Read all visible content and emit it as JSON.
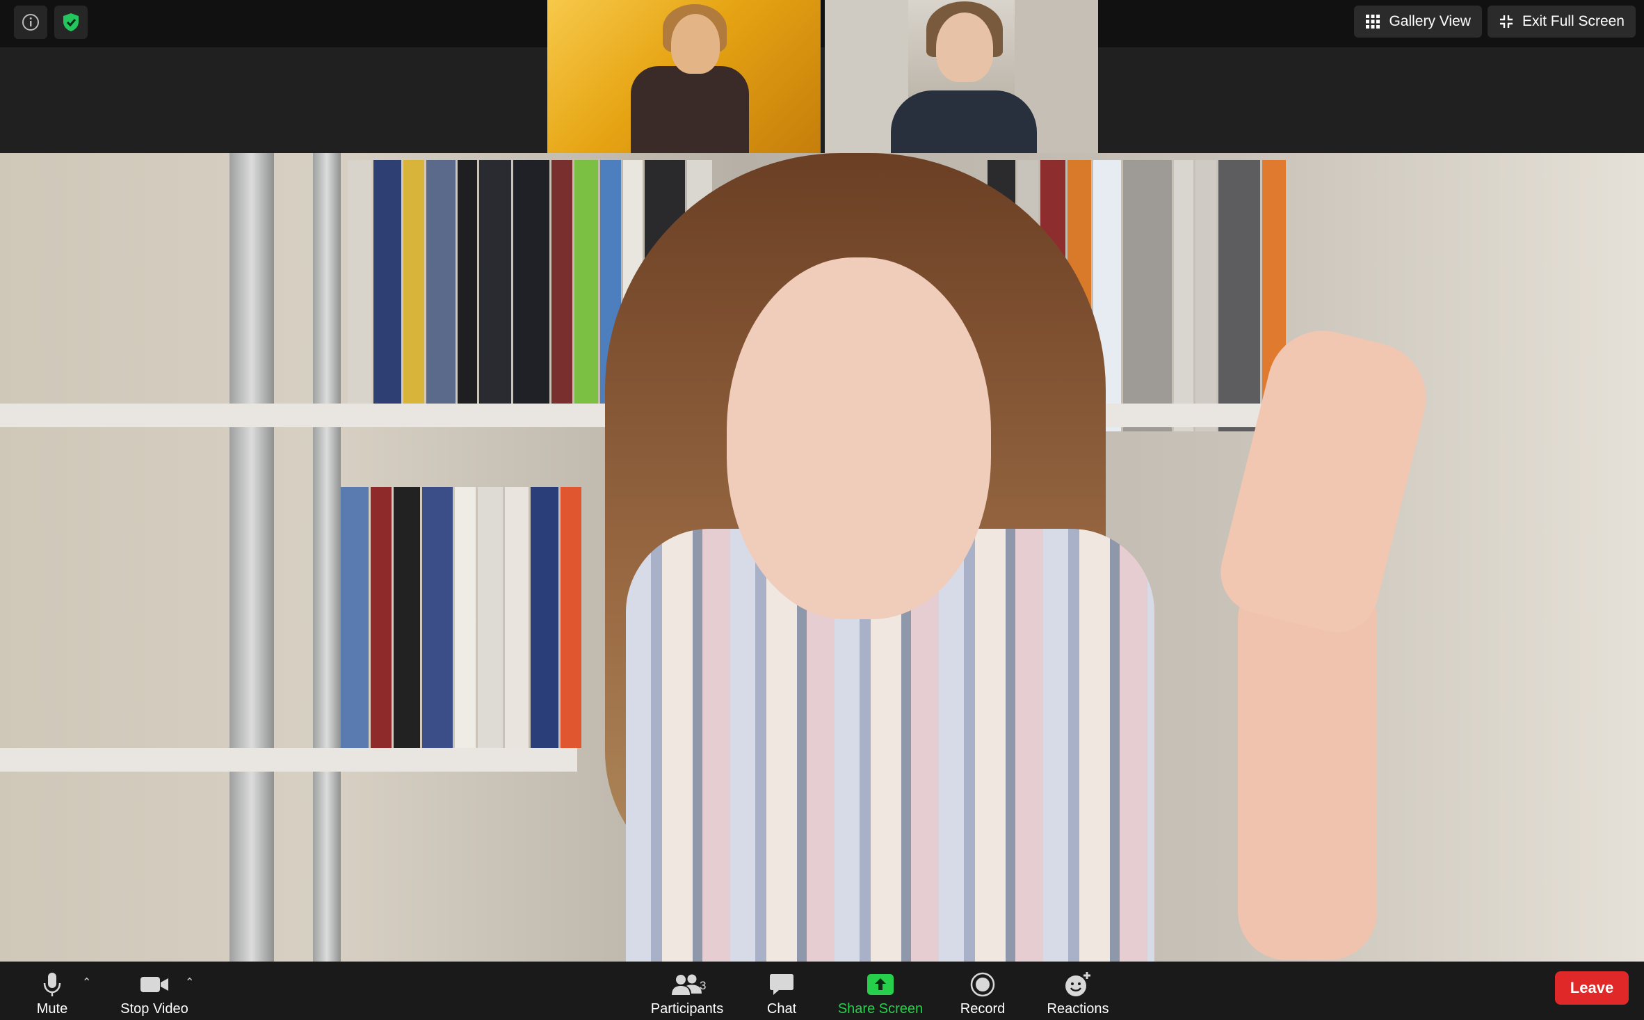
{
  "top_right": {
    "gallery_view_label": "Gallery View",
    "exit_full_screen_label": "Exit Full Screen"
  },
  "toolbar": {
    "mute_label": "Mute",
    "stop_video_label": "Stop Video",
    "participants_label": "Participants",
    "participants_count": "3",
    "chat_label": "Chat",
    "share_screen_label": "Share Screen",
    "record_label": "Record",
    "reactions_label": "Reactions",
    "leave_label": "Leave"
  },
  "icons": {
    "info": "info-icon",
    "security": "shield-check-icon",
    "gallery": "grid-icon",
    "exit_full": "exit-fullscreen-icon",
    "mic": "microphone-icon",
    "camera": "video-camera-icon",
    "participants": "people-icon",
    "chat": "chat-bubble-icon",
    "share": "share-screen-icon",
    "record": "record-icon",
    "reactions": "emoji-plus-icon"
  },
  "colors": {
    "share_green": "#27d04b",
    "leave_red": "#e02828",
    "security_green": "#22c55e"
  }
}
